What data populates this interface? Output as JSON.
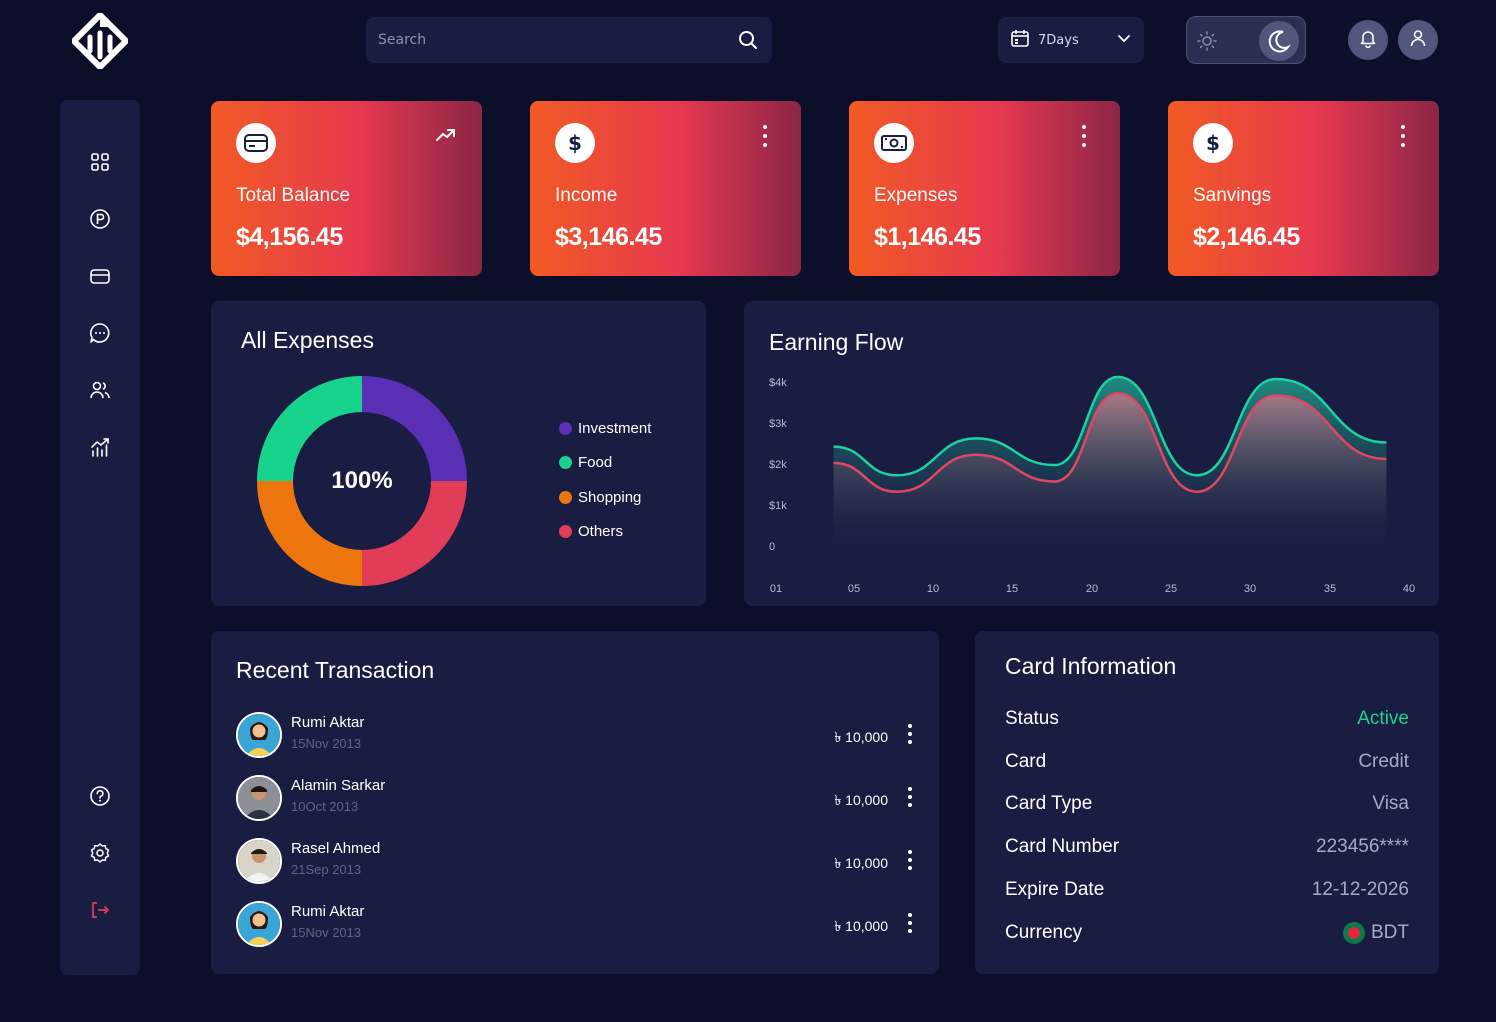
{
  "search": {
    "placeholder": "Search"
  },
  "period": {
    "selected": "7Days"
  },
  "stats": [
    {
      "title": "Total Balance",
      "value": "$4,156.45",
      "icon": "credit-card-icon"
    },
    {
      "title": "Income",
      "value": "$3,146.45",
      "icon": "dollar-icon"
    },
    {
      "title": "Expenses",
      "value": "$1,146.45",
      "icon": "banknote-icon"
    },
    {
      "title": "Sanvings",
      "value": "$2,146.45",
      "icon": "dollar-icon"
    }
  ],
  "expenses": {
    "title": "All Expenses",
    "center_label": "100%",
    "legend": [
      {
        "label": "Investment",
        "color": "#5b2fb5"
      },
      {
        "label": "Food",
        "color": "#17d38b"
      },
      {
        "label": "Shopping",
        "color": "#ec760d"
      },
      {
        "label": "Others",
        "color": "#e23d58"
      }
    ]
  },
  "chart_data": {
    "type": "area",
    "title": "Earning Flow",
    "y_ticks": [
      "$4k",
      "$3k",
      "$2k",
      "$1k",
      "0"
    ],
    "x_ticks": [
      "01",
      "05",
      "10",
      "15",
      "20",
      "25",
      "30",
      "35",
      "40"
    ],
    "ylim": [
      0,
      4000
    ],
    "xlim": [
      1,
      40
    ],
    "series": [
      {
        "color": "#1fd0a0",
        "points": [
          [
            3,
            2400
          ],
          [
            7,
            1700
          ],
          [
            12,
            2600
          ],
          [
            17,
            1950
          ],
          [
            21,
            4100
          ],
          [
            26,
            1700
          ],
          [
            31,
            4050
          ],
          [
            38,
            2500
          ]
        ]
      },
      {
        "color": "#e24662",
        "points": [
          [
            3,
            2000
          ],
          [
            7,
            1300
          ],
          [
            12,
            2200
          ],
          [
            17,
            1550
          ],
          [
            21,
            3700
          ],
          [
            26,
            1300
          ],
          [
            31,
            3650
          ],
          [
            38,
            2100
          ]
        ]
      }
    ]
  },
  "transactions": {
    "title": "Recent Transaction",
    "items": [
      {
        "name": "Rumi Aktar",
        "date": "15Nov 2013",
        "amount": "৳ 10,000"
      },
      {
        "name": "Alamin Sarkar",
        "date": "10Oct 2013",
        "amount": "৳ 10,000"
      },
      {
        "name": "Rasel Ahmed",
        "date": "21Sep 2013",
        "amount": "৳ 10,000"
      },
      {
        "name": "Rumi Aktar",
        "date": "15Nov 2013",
        "amount": "৳ 10,000"
      }
    ]
  },
  "card_info": {
    "title": "Card Information",
    "rows": [
      {
        "key": "Status",
        "value": "Active"
      },
      {
        "key": "Card",
        "value": "Credit"
      },
      {
        "key": "Card Type",
        "value": "Visa"
      },
      {
        "key": "Card Number",
        "value": "223456****"
      },
      {
        "key": "Expire Date",
        "value": "12-12-2026"
      },
      {
        "key": "Currency",
        "value": "BDT"
      }
    ]
  },
  "sidebar": {
    "top": [
      "dashboard-icon",
      "parking-icon",
      "card-icon",
      "chat-icon",
      "users-icon",
      "analytics-icon"
    ],
    "bottom": [
      "help-icon",
      "settings-icon",
      "logout-icon"
    ]
  },
  "colors": {
    "accent_active": "#1fd08f",
    "logout": "#e23d58"
  }
}
